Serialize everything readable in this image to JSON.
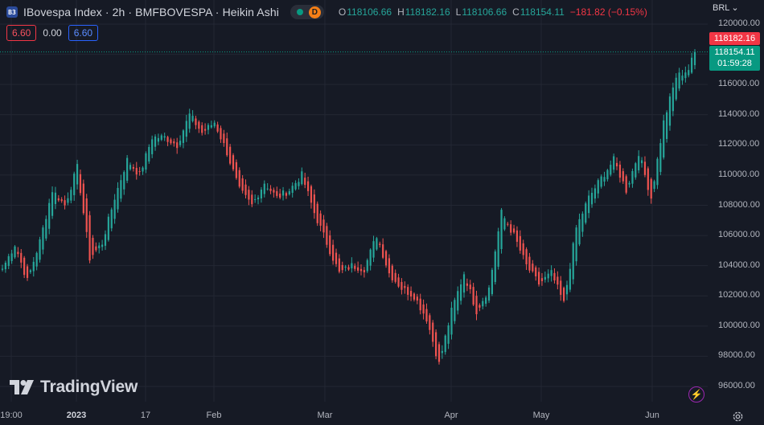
{
  "header": {
    "symbol_icon": "B3",
    "title": "IBovespa Index · 2h · BMFBOVESPA · Heikin Ashi",
    "status_badge": "D",
    "ohlc": {
      "o_label": "O",
      "o_value": "118106.66",
      "h_label": "H",
      "h_value": "118182.16",
      "l_label": "L",
      "l_value": "118106.66",
      "c_label": "C",
      "c_value": "118154.11",
      "change": "−181.82 (−0.15%)"
    }
  },
  "indicator": {
    "v1": "6.60",
    "v2": "0.00",
    "v3": "6.60"
  },
  "currency": "BRL",
  "price_labels": {
    "high": "118182.16",
    "last": "118154.11",
    "countdown": "01:59:28"
  },
  "logo_text": "TradingView",
  "colors": {
    "up": "#26a69a",
    "down": "#ef5350",
    "background": "#161a25",
    "grid": "#232733"
  },
  "chart_data": {
    "type": "candlestick",
    "style": "Heikin Ashi",
    "y_tick_labels": [
      "120000.00",
      "118000.00",
      "116000.00",
      "114000.00",
      "112000.00",
      "110000.00",
      "108000.00",
      "106000.00",
      "104000.00",
      "102000.00",
      "100000.00",
      "98000.00",
      "96000.00"
    ],
    "y_ticks": [
      120000,
      118000,
      116000,
      114000,
      112000,
      110000,
      108000,
      106000,
      104000,
      102000,
      100000,
      98000,
      96000
    ],
    "ylim": [
      95400,
      121600
    ],
    "x_tick_labels": [
      "19:00",
      "2023",
      "17",
      "Feb",
      "Mar",
      "Apr",
      "May",
      "Jun"
    ],
    "x_bold_labels": [
      "2023"
    ],
    "anchors": [
      {
        "i": 0,
        "v": 103800
      },
      {
        "i": 4,
        "v": 105400
      },
      {
        "i": 8,
        "v": 103000
      },
      {
        "i": 12,
        "v": 105600
      },
      {
        "i": 16,
        "v": 109000
      },
      {
        "i": 20,
        "v": 108000
      },
      {
        "i": 24,
        "v": 110500
      },
      {
        "i": 28,
        "v": 104500
      },
      {
        "i": 32,
        "v": 105500
      },
      {
        "i": 36,
        "v": 108500
      },
      {
        "i": 40,
        "v": 111000
      },
      {
        "i": 44,
        "v": 110000
      },
      {
        "i": 48,
        "v": 112500
      },
      {
        "i": 52,
        "v": 112500
      },
      {
        "i": 56,
        "v": 112000
      },
      {
        "i": 60,
        "v": 114000
      },
      {
        "i": 64,
        "v": 112800
      },
      {
        "i": 68,
        "v": 113500
      },
      {
        "i": 72,
        "v": 111500
      },
      {
        "i": 76,
        "v": 109000
      },
      {
        "i": 80,
        "v": 108000
      },
      {
        "i": 84,
        "v": 109500
      },
      {
        "i": 88,
        "v": 108500
      },
      {
        "i": 92,
        "v": 109000
      },
      {
        "i": 96,
        "v": 110000
      },
      {
        "i": 100,
        "v": 107500
      },
      {
        "i": 104,
        "v": 105500
      },
      {
        "i": 108,
        "v": 103500
      },
      {
        "i": 112,
        "v": 104000
      },
      {
        "i": 116,
        "v": 103800
      },
      {
        "i": 120,
        "v": 106000
      },
      {
        "i": 124,
        "v": 103500
      },
      {
        "i": 128,
        "v": 102500
      },
      {
        "i": 132,
        "v": 102000
      },
      {
        "i": 136,
        "v": 100500
      },
      {
        "i": 140,
        "v": 97500
      },
      {
        "i": 144,
        "v": 101000
      },
      {
        "i": 148,
        "v": 103500
      },
      {
        "i": 152,
        "v": 101000
      },
      {
        "i": 156,
        "v": 102500
      },
      {
        "i": 160,
        "v": 107500
      },
      {
        "i": 164,
        "v": 106000
      },
      {
        "i": 168,
        "v": 104000
      },
      {
        "i": 172,
        "v": 102800
      },
      {
        "i": 176,
        "v": 103500
      },
      {
        "i": 180,
        "v": 101500
      },
      {
        "i": 184,
        "v": 106500
      },
      {
        "i": 188,
        "v": 108500
      },
      {
        "i": 192,
        "v": 109800
      },
      {
        "i": 196,
        "v": 111000
      },
      {
        "i": 200,
        "v": 109000
      },
      {
        "i": 204,
        "v": 111500
      },
      {
        "i": 208,
        "v": 108500
      },
      {
        "i": 212,
        "v": 113500
      },
      {
        "i": 216,
        "v": 116500
      },
      {
        "i": 220,
        "v": 117000
      },
      {
        "i": 222,
        "v": 118154
      }
    ],
    "last_price": 118154.11,
    "high_price": 118182.16
  }
}
